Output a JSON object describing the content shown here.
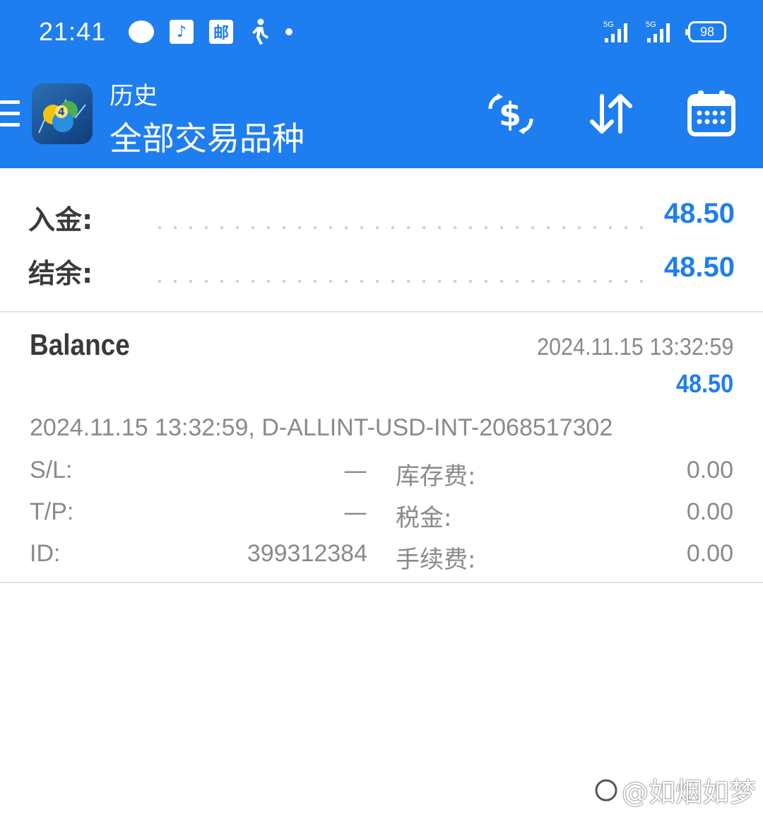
{
  "status_bar": {
    "time": "21:41",
    "battery": "98",
    "sq_icon_1": "♪",
    "sq_icon_2": "邮",
    "signal_1": "5G",
    "signal_2": "5G"
  },
  "header": {
    "subtitle": "历史",
    "title": "全部交易品种"
  },
  "summary": {
    "rows": [
      {
        "label": "入金:",
        "value": "48.50"
      },
      {
        "label": "结余:",
        "value": "48.50"
      }
    ]
  },
  "deal": {
    "type": "Balance",
    "time": "2024.11.15 13:32:59",
    "profit": "48.50",
    "comment": "2024.11.15 13:32:59, D-ALLINT-USD-INT-2068517302",
    "left_fields": [
      {
        "label": "S/L:",
        "value": "—"
      },
      {
        "label": "T/P:",
        "value": "—"
      },
      {
        "label": "ID:",
        "value": "399312384"
      }
    ],
    "right_fields": [
      {
        "label": "库存费:",
        "value": "0.00"
      },
      {
        "label": "税金:",
        "value": "0.00"
      },
      {
        "label": "手续费:",
        "value": "0.00"
      }
    ]
  },
  "watermark": "@如烟如梦",
  "colors": {
    "accent": "#1e7ef0",
    "text_primary": "#3a3a3a",
    "text_secondary": "#8a8a8a"
  },
  "icons": {
    "menu": "hamburger-icon",
    "currency": "dollar-exchange-icon",
    "sort": "sort-arrows-icon",
    "calendar": "calendar-icon"
  }
}
